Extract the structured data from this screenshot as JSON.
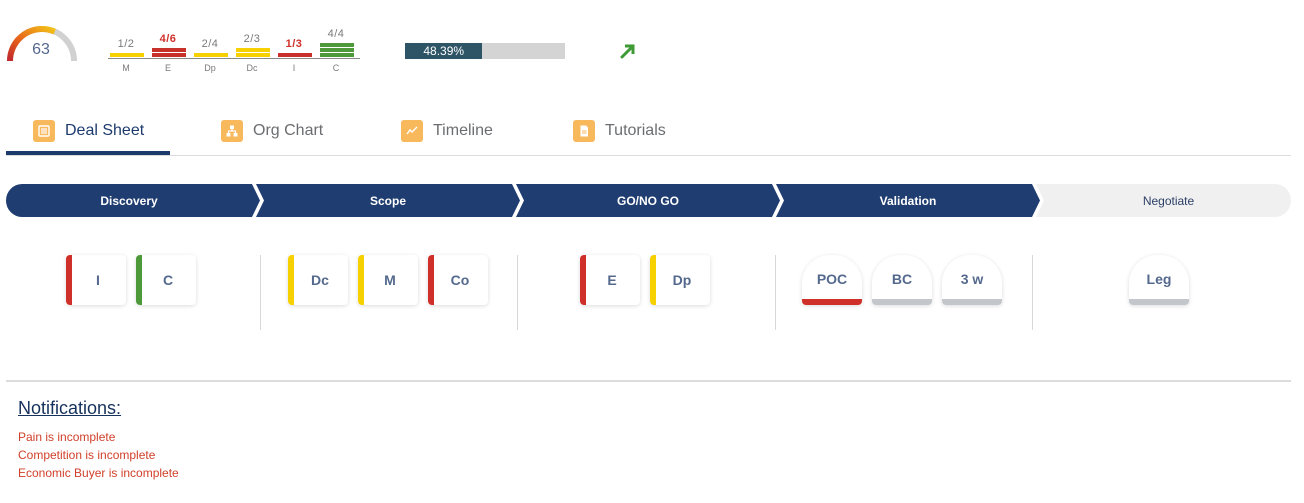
{
  "score": {
    "value": "63",
    "fraction": 0.63,
    "colors": [
      "#c1272d",
      "#e8651a",
      "#f3c318",
      "#d1d1d1"
    ]
  },
  "meddic": {
    "items": [
      {
        "label": "M",
        "fraction": "1/2",
        "done": 1,
        "total": 2,
        "color": "#f7d000",
        "text_color": "normal"
      },
      {
        "label": "E",
        "fraction": "4/6",
        "done": 2,
        "total": 6,
        "color": "#c8302a",
        "text_color": "red"
      },
      {
        "label": "Dp",
        "fraction": "2/4",
        "done": 1,
        "total": 4,
        "color": "#f7d000",
        "text_color": "normal"
      },
      {
        "label": "Dc",
        "fraction": "2/3",
        "done": 2,
        "total": 3,
        "color": "#f7d000",
        "text_color": "normal"
      },
      {
        "label": "I",
        "fraction": "1/3",
        "done": 1,
        "total": 3,
        "color": "#c8302a",
        "text_color": "red"
      },
      {
        "label": "C",
        "fraction": "4/4",
        "done": 3,
        "total": 4,
        "color": "#4e9a3a",
        "text_color": "normal"
      }
    ]
  },
  "progress": {
    "label": "48.39%",
    "percent": 48.39
  },
  "trend": {
    "icon": "trend-up-arrow-icon",
    "color": "#3e9a34"
  },
  "tabs": [
    {
      "label": "Deal Sheet",
      "icon": "list-icon",
      "active": true
    },
    {
      "label": "Org Chart",
      "icon": "hierarchy-icon",
      "active": false
    },
    {
      "label": "Timeline",
      "icon": "line-chart-icon",
      "active": false
    },
    {
      "label": "Tutorials",
      "icon": "document-icon",
      "active": false
    }
  ],
  "stages": [
    {
      "label": "Discovery",
      "complete": true
    },
    {
      "label": "Scope",
      "complete": true
    },
    {
      "label": "GO/NO GO",
      "complete": true
    },
    {
      "label": "Validation",
      "complete": true
    },
    {
      "label": "Negotiate",
      "complete": false
    }
  ],
  "checkpoints": {
    "discovery": [
      {
        "label": "I",
        "color": "#d0302a"
      },
      {
        "label": "C",
        "color": "#4e9a3a"
      }
    ],
    "scope": [
      {
        "label": "Dc",
        "color": "#f7d000"
      },
      {
        "label": "M",
        "color": "#f7d000"
      },
      {
        "label": "Co",
        "color": "#d0302a"
      }
    ],
    "gonogo": [
      {
        "label": "E",
        "color": "#d0302a"
      },
      {
        "label": "Dp",
        "color": "#f7d000"
      }
    ],
    "validation": [
      {
        "label": "POC",
        "color": "#d0302a"
      },
      {
        "label": "BC",
        "color": "#c3c7cc"
      },
      {
        "label": "3 w",
        "color": "#c3c7cc"
      }
    ],
    "negotiate": [
      {
        "label": "Leg",
        "color": "#c3c7cc"
      }
    ]
  },
  "notifications": {
    "title": "Notifications:",
    "items": [
      "Pain is incomplete",
      "Competition is incomplete",
      "Economic Buyer is incomplete"
    ]
  }
}
